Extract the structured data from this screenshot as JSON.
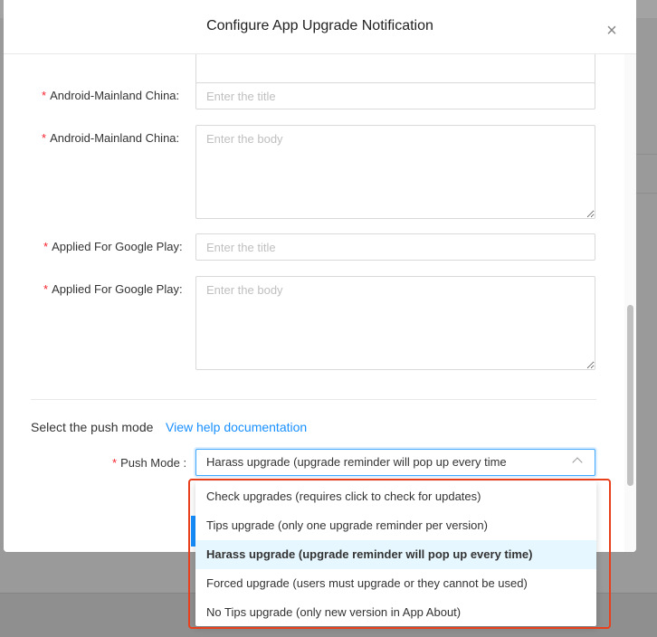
{
  "dialog": {
    "title": "Configure App Upgrade Notification",
    "close_symbol": "×"
  },
  "fields": [
    {
      "label": "Android-Mainland China",
      "placeholder": "Enter the title",
      "required": true
    },
    {
      "label": "Android-Mainland China",
      "placeholder": "Enter the body",
      "required": true
    },
    {
      "label": "Applied For Google Play",
      "placeholder": "Enter the title",
      "required": true
    },
    {
      "label": "Applied For Google Play",
      "placeholder": "Enter the body",
      "required": true
    }
  ],
  "push_section": {
    "title": "Select the push mode",
    "help_link": "View help documentation",
    "push_mode_label": "Push Mode",
    "selected_value": "Harass upgrade (upgrade reminder will pop up every time"
  },
  "dropdown": {
    "options": [
      "Check upgrades (requires click to check for updates)",
      "Tips upgrade (only one upgrade reminder per version)",
      "Harass upgrade (upgrade reminder will pop up every time)",
      "Forced upgrade (users must upgrade or they cannot be used)",
      "No Tips upgrade (only new version in App About)"
    ],
    "selected_index": 2
  },
  "colors": {
    "accent": "#1890ff",
    "required": "#f5222d",
    "highlight": "#e8401c",
    "selected_bg": "#e6f7ff"
  }
}
